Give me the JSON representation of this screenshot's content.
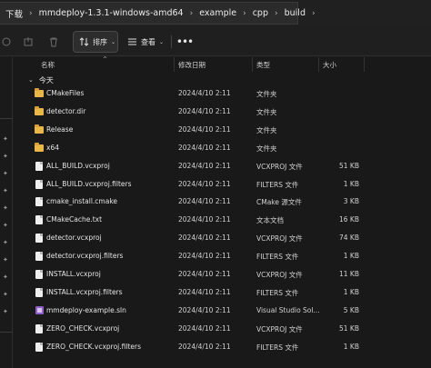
{
  "breadcrumb": [
    "下载",
    "mmdeploy-1.3.1-windows-amd64",
    "example",
    "cpp",
    "build"
  ],
  "toolbar": {
    "sort_label": "排序",
    "view_label": "查看",
    "more_label": "•••"
  },
  "columns": {
    "name": "名称",
    "date": "修改日期",
    "type": "类型",
    "size": "大小"
  },
  "group": {
    "label": "今天"
  },
  "files": [
    {
      "name": "CMakeFiles",
      "date": "2024/4/10 2:11",
      "type": "文件夹",
      "size": "",
      "icon": "folder-icon"
    },
    {
      "name": "detector.dir",
      "date": "2024/4/10 2:11",
      "type": "文件夹",
      "size": "",
      "icon": "folder-icon"
    },
    {
      "name": "Release",
      "date": "2024/4/10 2:11",
      "type": "文件夹",
      "size": "",
      "icon": "folder-icon"
    },
    {
      "name": "x64",
      "date": "2024/4/10 2:11",
      "type": "文件夹",
      "size": "",
      "icon": "folder-icon"
    },
    {
      "name": "ALL_BUILD.vcxproj",
      "date": "2024/4/10 2:11",
      "type": "VCXPROJ 文件",
      "size": "51 KB",
      "icon": "file-icon"
    },
    {
      "name": "ALL_BUILD.vcxproj.filters",
      "date": "2024/4/10 2:11",
      "type": "FILTERS 文件",
      "size": "1 KB",
      "icon": "file-icon"
    },
    {
      "name": "cmake_install.cmake",
      "date": "2024/4/10 2:11",
      "type": "CMake 源文件",
      "size": "3 KB",
      "icon": "file-icon"
    },
    {
      "name": "CMakeCache.txt",
      "date": "2024/4/10 2:11",
      "type": "文本文档",
      "size": "16 KB",
      "icon": "file-icon"
    },
    {
      "name": "detector.vcxproj",
      "date": "2024/4/10 2:11",
      "type": "VCXPROJ 文件",
      "size": "74 KB",
      "icon": "file-icon"
    },
    {
      "name": "detector.vcxproj.filters",
      "date": "2024/4/10 2:11",
      "type": "FILTERS 文件",
      "size": "1 KB",
      "icon": "file-icon"
    },
    {
      "name": "INSTALL.vcxproj",
      "date": "2024/4/10 2:11",
      "type": "VCXPROJ 文件",
      "size": "11 KB",
      "icon": "file-icon"
    },
    {
      "name": "INSTALL.vcxproj.filters",
      "date": "2024/4/10 2:11",
      "type": "FILTERS 文件",
      "size": "1 KB",
      "icon": "file-icon"
    },
    {
      "name": "mmdeploy-example.sln",
      "date": "2024/4/10 2:11",
      "type": "Visual Studio Sol...",
      "size": "5 KB",
      "icon": "solution-icon"
    },
    {
      "name": "ZERO_CHECK.vcxproj",
      "date": "2024/4/10 2:11",
      "type": "VCXPROJ 文件",
      "size": "51 KB",
      "icon": "file-icon"
    },
    {
      "name": "ZERO_CHECK.vcxproj.filters",
      "date": "2024/4/10 2:11",
      "type": "FILTERS 文件",
      "size": "1 KB",
      "icon": "file-icon"
    }
  ],
  "colors": {
    "folder": "#e8b746",
    "background": "#191919",
    "solution": "#8e5ec9"
  }
}
